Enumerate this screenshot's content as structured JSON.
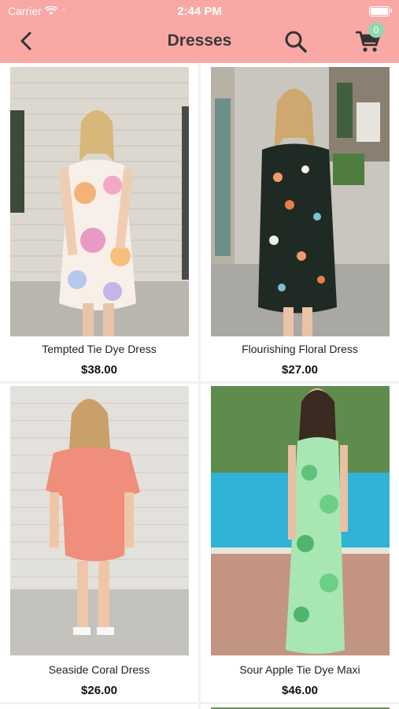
{
  "status_bar": {
    "carrier": "Carrier",
    "time": "2:44 PM"
  },
  "nav": {
    "title": "Dresses",
    "cart_count": "0"
  },
  "colors": {
    "header_bg": "#f9a8a5",
    "badge": "#8ed8b0"
  },
  "products": [
    {
      "name": "Tempted Tie Dye Dress",
      "price": "$38.00"
    },
    {
      "name": "Flourishing Floral Dress",
      "price": "$27.00"
    },
    {
      "name": "Seaside Coral Dress",
      "price": "$26.00"
    },
    {
      "name": "Sour Apple Tie Dye Maxi",
      "price": "$46.00"
    }
  ]
}
